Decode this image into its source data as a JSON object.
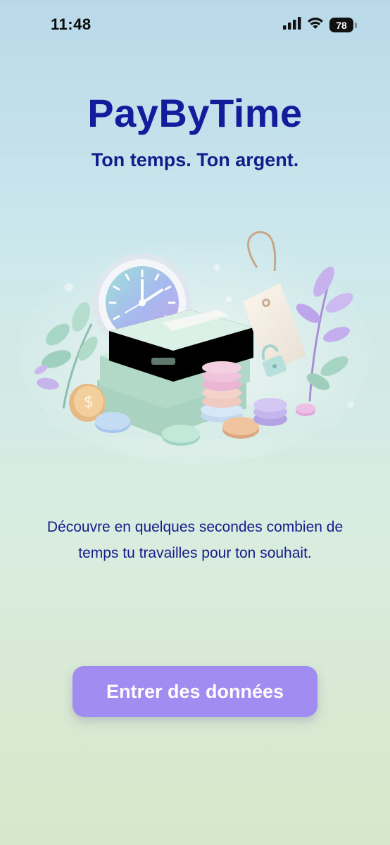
{
  "status_bar": {
    "time": "11:48",
    "battery_level": "78",
    "icons": [
      "signal-icon",
      "wifi-icon",
      "battery-icon"
    ]
  },
  "header": {
    "title": "PayByTime",
    "tagline": "Ton temps. Ton argent."
  },
  "main": {
    "illustration": "clock-money-coins-price-tag-illustration",
    "description": "Découvre en quelques secondes combien de temps tu travailles pour ton souhait."
  },
  "cta": {
    "label": "Entrer des données"
  },
  "colors": {
    "primary_text": "#141c9c",
    "button": "#a18df2",
    "button_text": "#ffffff"
  }
}
